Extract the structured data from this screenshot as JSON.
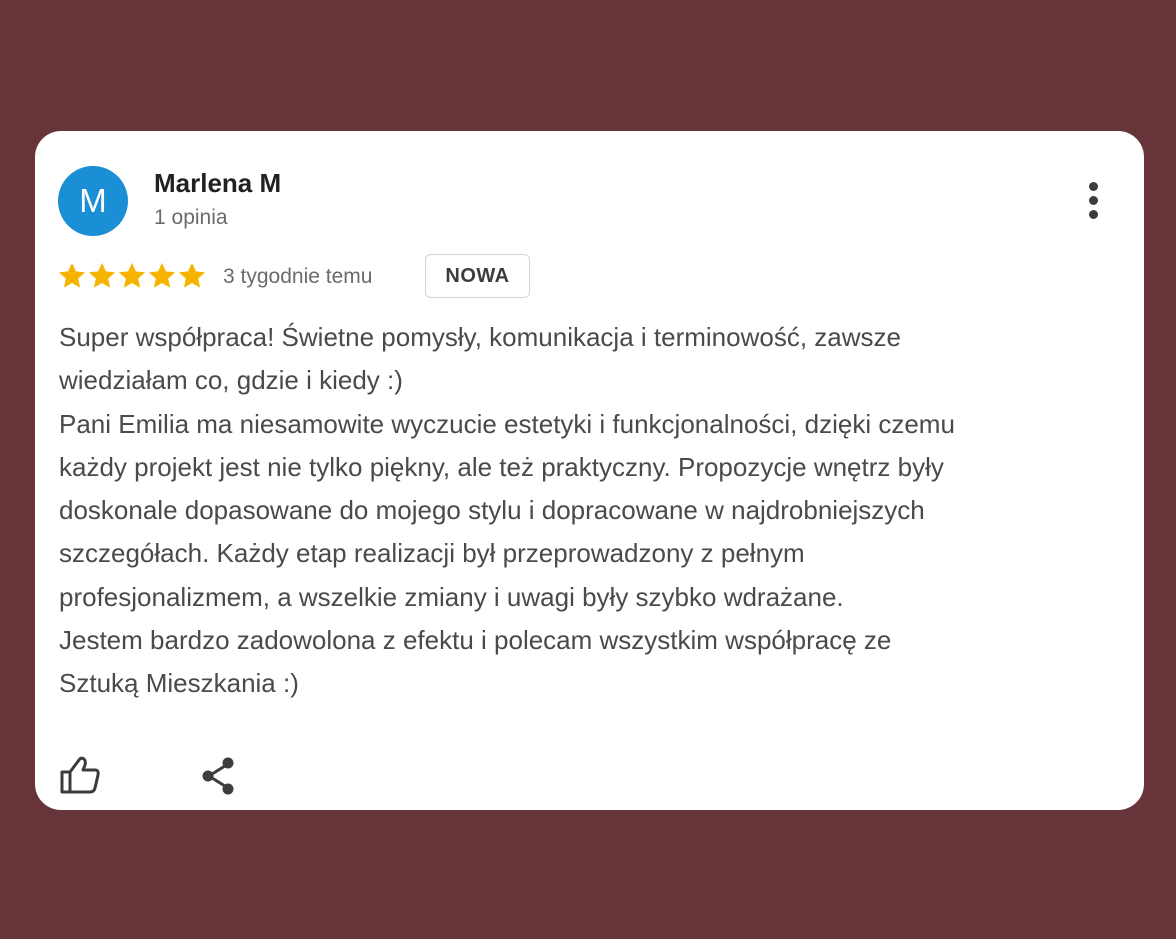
{
  "review": {
    "author": {
      "initial": "M",
      "name": "Marlena M",
      "meta": "1 opinia"
    },
    "rating": 5,
    "time_ago": "3 tygodnie temu",
    "badge": "NOWA",
    "text_lines": [
      "Super współpraca! Świetne pomysły, komunikacja i terminowość, zawsze",
      "wiedziałam co, gdzie i kiedy :)",
      "Pani Emilia ma niesamowite wyczucie estetyki i funkcjonalności, dzięki czemu",
      "każdy projekt jest nie tylko piękny, ale też praktyczny. Propozycje wnętrz były",
      "doskonale dopasowane do mojego stylu i dopracowane w najdrobniejszych",
      "szczegółach. Każdy etap realizacji był przeprowadzony z pełnym",
      "profesjonalizmem, a wszelkie zmiany i uwagi były szybko wdrażane.",
      "Jestem bardzo zadowolona z efektu i polecam wszystkim współpracę ze",
      "Sztuką Mieszkania :)"
    ],
    "actions": {
      "like_icon": "thumbs-up-icon",
      "share_icon": "share-icon",
      "more_icon": "more-vertical-icon"
    }
  },
  "colors": {
    "background": "#673539",
    "card": "#ffffff",
    "avatar": "#1a8fd6",
    "star": "#f6b400",
    "text": "#4a4a4a"
  }
}
